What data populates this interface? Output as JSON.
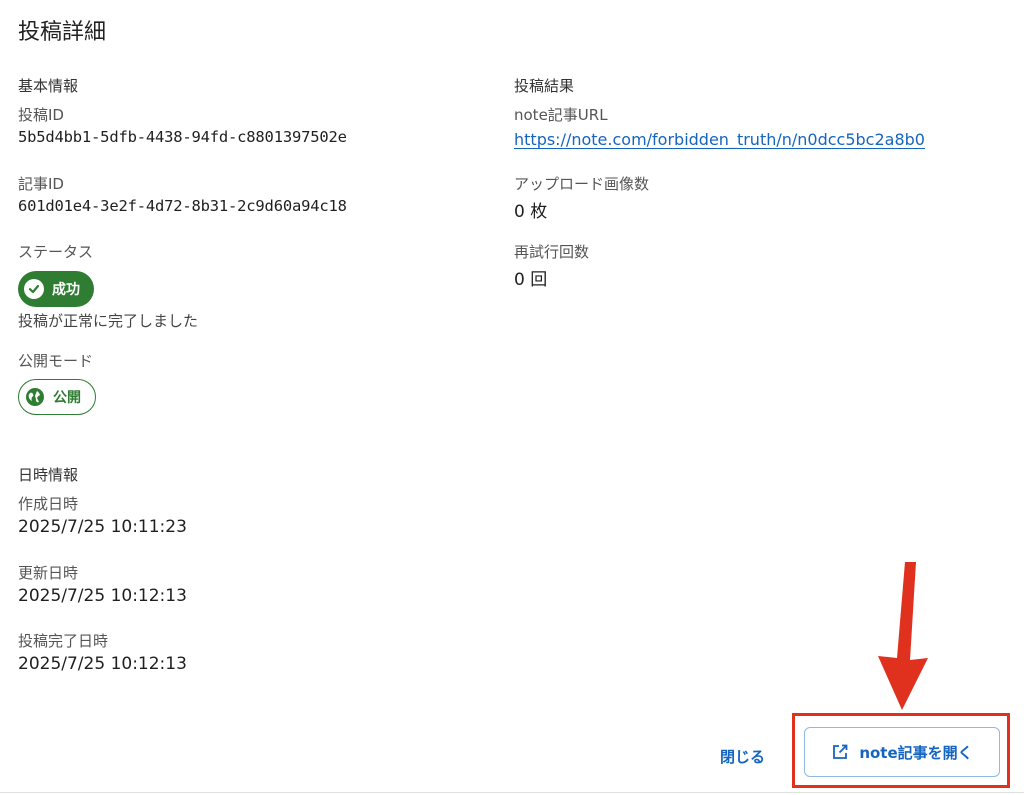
{
  "dialog": {
    "title": "投稿詳細"
  },
  "basic_info": {
    "heading": "基本情報",
    "post_id_label": "投稿ID",
    "post_id": "5b5d4bb1-5dfb-4438-94fd-c8801397502e",
    "article_id_label": "記事ID",
    "article_id": "601d01e4-3e2f-4d72-8b31-2c9d60a94c18",
    "status_label": "ステータス",
    "status_chip": "成功",
    "status_message": "投稿が正常に完了しました",
    "publish_mode_label": "公開モード",
    "publish_mode_chip": "公開"
  },
  "result": {
    "heading": "投稿結果",
    "url_label": "note記事URL",
    "url": "https://note.com/forbidden_truth/n/n0dcc5bc2a8b0",
    "images_label": "アップロード画像数",
    "images_value": "0 枚",
    "retries_label": "再試行回数",
    "retries_value": "0 回"
  },
  "datetime_info": {
    "heading": "日時情報",
    "created_label": "作成日時",
    "created": "2025/7/25 10:11:23",
    "updated_label": "更新日時",
    "updated": "2025/7/25 10:12:13",
    "completed_label": "投稿完了日時",
    "completed": "2025/7/25 10:12:13"
  },
  "actions": {
    "close_label": "閉じる",
    "open_note_label": "note記事を開く"
  },
  "icons": {
    "status": "check-circle-icon",
    "public": "globe-icon",
    "open": "open-in-new-icon",
    "annotation": "arrow-down-icon"
  },
  "colors": {
    "success": "#2e7d32",
    "link": "#1565c0",
    "annotation": "#e0301e"
  }
}
